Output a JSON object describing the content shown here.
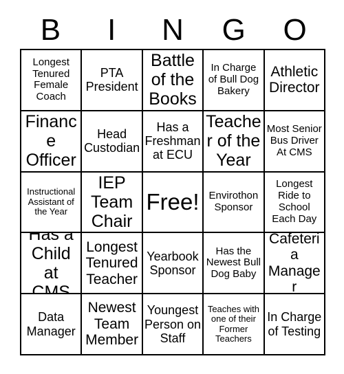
{
  "card": {
    "title": "BINGO",
    "header_letters": [
      "B",
      "I",
      "N",
      "G",
      "O"
    ],
    "columns": 5,
    "rows": 5,
    "border_color": "#000000",
    "background_color": "#ffffff",
    "text_color": "#000000",
    "free_space_label": "Free!",
    "free_space_position": {
      "row": 3,
      "column": 3
    },
    "cells": [
      [
        {
          "text": "Longest Tenured Female Coach",
          "size": "sm",
          "free": false
        },
        {
          "text": "PTA President",
          "size": "md",
          "free": false
        },
        {
          "text": "Battle of the Books",
          "size": "xl",
          "free": false
        },
        {
          "text": "In Charge of Bull Dog Bakery",
          "size": "sm",
          "free": false
        },
        {
          "text": "Athletic Director",
          "size": "lg",
          "free": false
        }
      ],
      [
        {
          "text": "Finance Officer",
          "size": "xl",
          "free": false
        },
        {
          "text": "Head Custodian",
          "size": "md",
          "free": false
        },
        {
          "text": "Has a Freshman at ECU",
          "size": "md",
          "free": false
        },
        {
          "text": "Teacher of the Year",
          "size": "xl",
          "free": false
        },
        {
          "text": "Most Senior Bus Driver At CMS",
          "size": "sm",
          "free": false
        }
      ],
      [
        {
          "text": "Instructional Assistant of the Year",
          "size": "xs",
          "free": false
        },
        {
          "text": "IEP Team Chair",
          "size": "xl",
          "free": false
        },
        {
          "text": "Free!",
          "size": "free",
          "free": true
        },
        {
          "text": "Envirothon Sponsor",
          "size": "sm",
          "free": false
        },
        {
          "text": "Longest Ride to School Each Day",
          "size": "sm",
          "free": false
        }
      ],
      [
        {
          "text": "Has a Child at CMS",
          "size": "xl",
          "free": false
        },
        {
          "text": "Longest Tenured Teacher",
          "size": "lg",
          "free": false
        },
        {
          "text": "Yearbook Sponsor",
          "size": "md",
          "free": false
        },
        {
          "text": "Has the Newest Bull Dog Baby",
          "size": "sm",
          "free": false
        },
        {
          "text": "Cafeteria Manager",
          "size": "lg",
          "free": false
        }
      ],
      [
        {
          "text": "Data Manager",
          "size": "md",
          "free": false
        },
        {
          "text": "Newest Team Member",
          "size": "lg",
          "free": false
        },
        {
          "text": "Youngest Person on Staff",
          "size": "md",
          "free": false
        },
        {
          "text": "Teaches with one of their Former Teachers",
          "size": "xs",
          "free": false
        },
        {
          "text": "In Charge of Testing",
          "size": "md",
          "free": false
        }
      ]
    ]
  }
}
